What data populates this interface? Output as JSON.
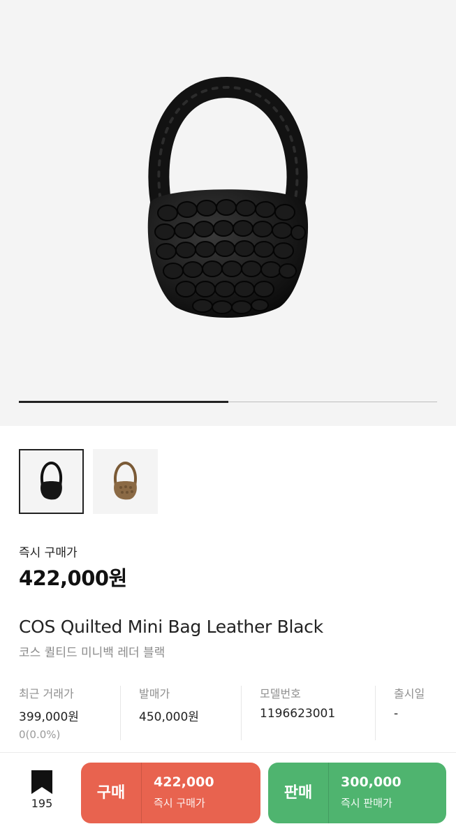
{
  "gallery": {
    "progress_fraction": 0.5,
    "images": [
      {
        "name": "product-image-black",
        "color": "#1a1a1a"
      },
      {
        "name": "product-image-brown",
        "color": "#8b6a45"
      }
    ]
  },
  "price": {
    "label": "즉시 구매가",
    "value": "422,000원"
  },
  "product": {
    "title_en": "COS Quilted Mini Bag Leather Black",
    "title_ko": "코스 퀼티드 미니백 레더 블랙"
  },
  "info": [
    {
      "label": "최근 거래가",
      "value": "399,000원",
      "sub": "0(0.0%)"
    },
    {
      "label": "발매가",
      "value": "450,000원",
      "sub": ""
    },
    {
      "label": "모델번호",
      "value": "1196623001",
      "sub": ""
    },
    {
      "label": "출시일",
      "value": "-",
      "sub": ""
    }
  ],
  "bottom": {
    "bookmark_count": "195",
    "bookmark_icon": "bookmark-icon",
    "buy": {
      "label": "구매",
      "amount": "422,000",
      "caption": "즉시 구매가",
      "color": "#e8634f"
    },
    "sell": {
      "label": "판매",
      "amount": "300,000",
      "caption": "즉시 판매가",
      "color": "#4fb46f"
    }
  }
}
